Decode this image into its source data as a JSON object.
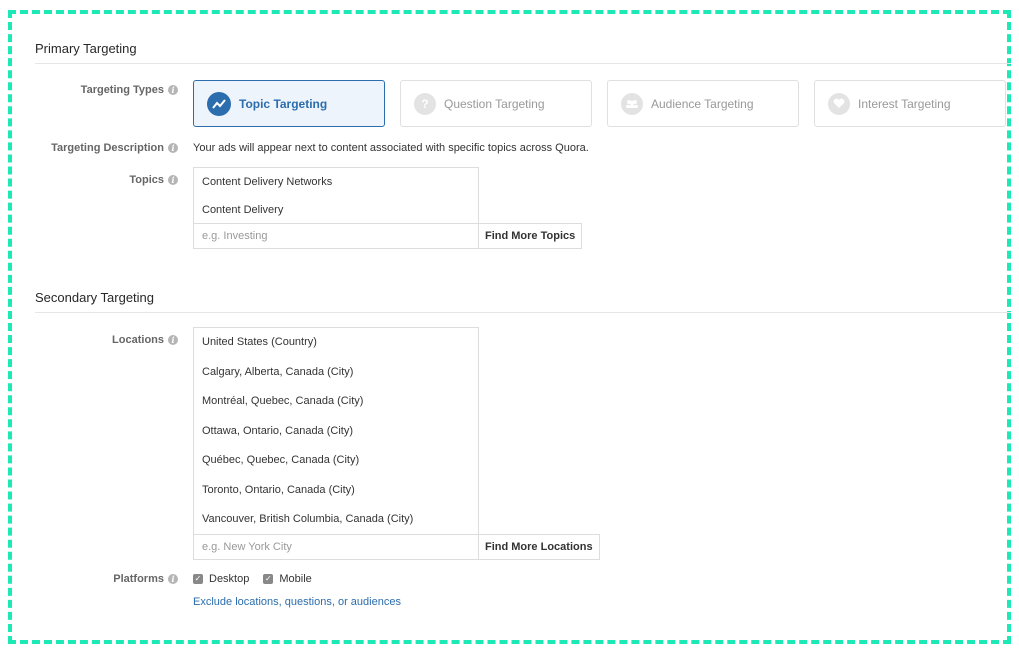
{
  "primary": {
    "title": "Primary Targeting",
    "targeting_types_label": "Targeting Types",
    "types": [
      {
        "label": "Topic Targeting",
        "selected": true,
        "icon": "trending-up-icon"
      },
      {
        "label": "Question Targeting",
        "selected": false,
        "icon": "question-icon"
      },
      {
        "label": "Audience Targeting",
        "selected": false,
        "icon": "people-icon"
      },
      {
        "label": "Interest Targeting",
        "selected": false,
        "icon": "heart-icon"
      }
    ],
    "description_label": "Targeting Description",
    "description": "Your ads will appear next to content associated with specific topics across Quora.",
    "topics_label": "Topics",
    "topics": [
      "Content Delivery Networks",
      "Content Delivery"
    ],
    "topics_placeholder": "e.g. Investing",
    "find_topics_button": "Find More Topics"
  },
  "secondary": {
    "title": "Secondary Targeting",
    "locations_label": "Locations",
    "locations": [
      "United States (Country)",
      "Calgary, Alberta, Canada (City)",
      "Montréal, Quebec, Canada (City)",
      "Ottawa, Ontario, Canada (City)",
      "Québec, Quebec, Canada (City)",
      "Toronto, Ontario, Canada (City)",
      "Vancouver, British Columbia, Canada (City)"
    ],
    "locations_placeholder": "e.g. New York City",
    "find_locations_button": "Find More Locations",
    "platforms_label": "Platforms",
    "platforms": [
      {
        "label": "Desktop",
        "checked": true
      },
      {
        "label": "Mobile",
        "checked": true
      }
    ],
    "exclude": {
      "prefix": "Exclude ",
      "locations": "locations",
      "sep1": ", ",
      "questions": "questions",
      "sep2": ", or ",
      "audiences": "audiences"
    }
  },
  "colors": {
    "accent": "#2b6dad",
    "frame": "#1de9b6"
  }
}
